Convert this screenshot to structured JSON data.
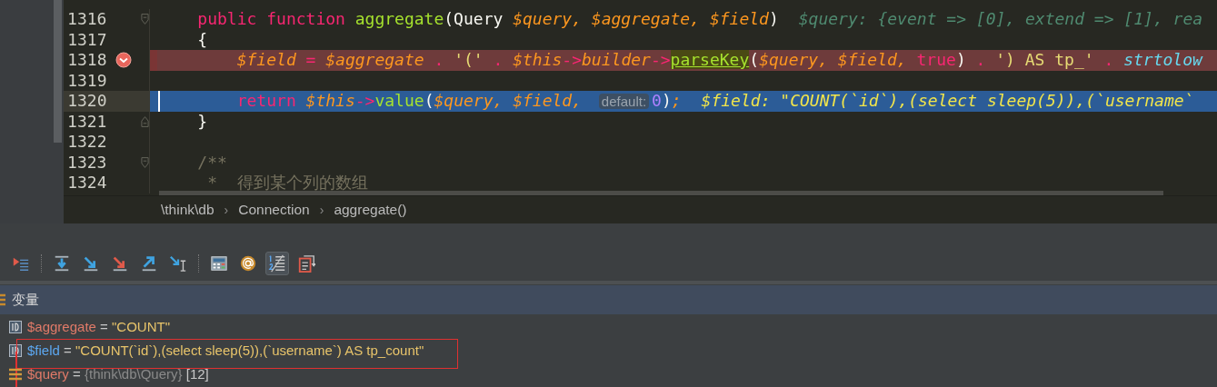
{
  "editor": {
    "lines": [
      {
        "number": "1316",
        "breakpoint": false,
        "current": false,
        "fold_start": true,
        "fold_end": false,
        "segments": [
          {
            "kind": "code",
            "tokens": [
              {
                "t": "    public function",
                "kind": "kw"
              },
              {
                "t": " aggregate",
                "kind": "fn"
              },
              {
                "t": "(Query ",
                "kind": "plain"
              },
              {
                "t": "$query, $aggregate, $field",
                "kind": "var"
              },
              {
                "t": ")",
                "kind": "plain"
              }
            ]
          },
          {
            "kind": "hint",
            "text": "$query: {event => [0], extend => [1], rea"
          }
        ]
      },
      {
        "number": "1317",
        "breakpoint": false,
        "current": false,
        "fold_start": false,
        "fold_end": false,
        "segments": [
          {
            "kind": "code",
            "tokens": [
              {
                "t": "    {",
                "kind": "plain"
              }
            ]
          }
        ]
      },
      {
        "number": "1318",
        "breakpoint": true,
        "current": false,
        "fold_start": false,
        "fold_end": false,
        "segments": [
          {
            "kind": "code",
            "tokens": [
              {
                "t": "        $field",
                "kind": "var"
              },
              {
                "t": " = ",
                "kind": "kw"
              },
              {
                "t": "$aggregate",
                "kind": "var"
              },
              {
                "t": " . ",
                "kind": "kw"
              },
              {
                "t": "'('",
                "kind": "str"
              },
              {
                "t": " . ",
                "kind": "kw"
              },
              {
                "t": "$this",
                "kind": "var"
              },
              {
                "t": "->",
                "kind": "kw"
              },
              {
                "t": "builder",
                "kind": "var"
              },
              {
                "t": "->",
                "kind": "kw"
              },
              {
                "t": "parseKey",
                "kind": "match"
              },
              {
                "t": "(",
                "kind": "plain"
              },
              {
                "t": "$query, $field, ",
                "kind": "var"
              },
              {
                "t": "true",
                "kind": "kw"
              },
              {
                "t": ")",
                "kind": "plain"
              },
              {
                "t": " . ",
                "kind": "kw"
              },
              {
                "t": "') AS tp_'",
                "kind": "str"
              },
              {
                "t": " . ",
                "kind": "kw"
              },
              {
                "t": "strtolow",
                "kind": "builtin"
              }
            ]
          }
        ]
      },
      {
        "number": "1319",
        "breakpoint": false,
        "current": false,
        "fold_start": false,
        "fold_end": false
      },
      {
        "number": "1320",
        "breakpoint": false,
        "current": true,
        "fold_start": false,
        "fold_end": false,
        "segments": [
          {
            "kind": "code",
            "tokens": [
              {
                "t": "        return",
                "kind": "kw"
              },
              {
                "t": " $this",
                "kind": "var"
              },
              {
                "t": "->",
                "kind": "kw"
              },
              {
                "t": "value",
                "kind": "fn"
              },
              {
                "t": "(",
                "kind": "plain"
              },
              {
                "t": "$query, $field, ",
                "kind": "var"
              }
            ]
          },
          {
            "kind": "inlay",
            "text": "default:"
          },
          {
            "kind": "code",
            "tokens": [
              {
                "t": "0",
                "kind": "num"
              },
              {
                "t": ")",
                "kind": "plain"
              },
              {
                "t": ";",
                "kind": "var"
              }
            ]
          },
          {
            "kind": "hint",
            "text": "$field: \"COUNT(`id`),(select sleep(5)),(`username`"
          }
        ]
      },
      {
        "number": "1321",
        "breakpoint": false,
        "current": false,
        "fold_start": false,
        "fold_end": true,
        "segments": [
          {
            "kind": "code",
            "tokens": [
              {
                "t": "    }",
                "kind": "plain"
              }
            ]
          }
        ]
      },
      {
        "number": "1322",
        "breakpoint": false,
        "current": false,
        "fold_start": false,
        "fold_end": false
      },
      {
        "number": "1323",
        "breakpoint": false,
        "current": false,
        "fold_start": true,
        "fold_end": false,
        "segments": [
          {
            "kind": "code",
            "tokens": [
              {
                "t": "    /**",
                "kind": "cmt"
              }
            ]
          }
        ]
      },
      {
        "number": "1324",
        "breakpoint": false,
        "current": false,
        "fold_start": false,
        "fold_end": false,
        "segments": [
          {
            "kind": "code",
            "tokens": [
              {
                "t": "     *  得到某个列的数组",
                "kind": "cmt"
              }
            ]
          }
        ]
      }
    ]
  },
  "breadcrumbs": [
    {
      "kind": "crumb",
      "text": "\\think\\db"
    },
    {
      "kind": "separator",
      "text": "›"
    },
    {
      "kind": "crumb",
      "text": "Connection"
    },
    {
      "kind": "separator",
      "text": "›"
    },
    {
      "kind": "crumb",
      "text": "aggregate()"
    }
  ],
  "toolbar": [
    {
      "selected": false
    },
    {
      "selected": false
    },
    {
      "selected": false
    },
    {
      "selected": false
    },
    {
      "selected": false
    },
    {
      "selected": false
    },
    {
      "selected": false
    },
    {
      "selected": false
    },
    {
      "selected": true
    },
    {
      "selected": false
    }
  ],
  "variables_panel": {
    "title": "变量",
    "variables": [
      {
        "kind": "string",
        "name": "$aggregate",
        "operator": "=",
        "value": "\"COUNT\"",
        "changed": false,
        "highlighted": false
      },
      {
        "kind": "string",
        "name": "$field",
        "operator": "=",
        "value": "\"COUNT(`id`),(select sleep(5)),(`username`) AS tp_count\"",
        "changed": true,
        "highlighted": true
      },
      {
        "kind": "object",
        "name": "$query",
        "operator": "=",
        "value": "{think\\db\\Query}",
        "count": "[12]",
        "changed": false,
        "highlighted": false
      }
    ]
  }
}
